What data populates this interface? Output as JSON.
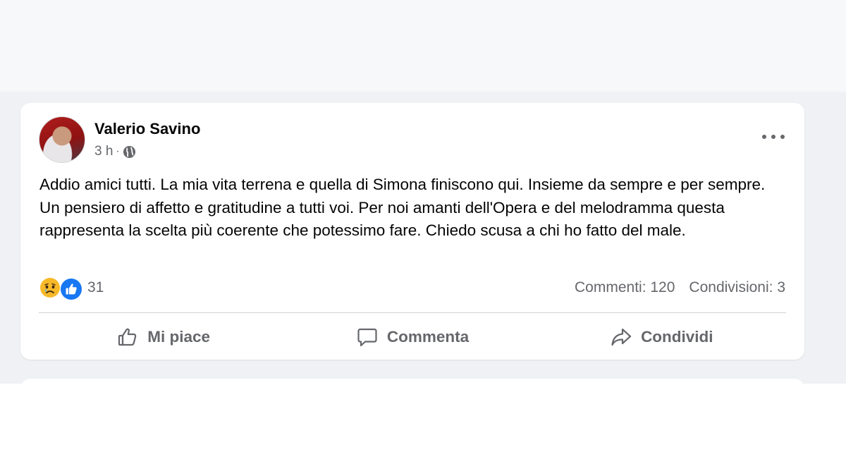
{
  "post": {
    "author": "Valerio Savino",
    "time": "3 h",
    "separator": "·",
    "text": "Addio amici tutti. La mia vita terrena e quella di Simona finiscono qui. Insieme da sempre e per sempre. Un pensiero di affetto e gratitudine a tutti voi. Per noi amanti dell'Opera e del melodramma questa rappresenta la scelta più coerente che potessimo fare. Chiedo scusa a chi ho fatto del male.",
    "reactions": {
      "icons": [
        "sad-reaction-icon",
        "like-reaction-icon"
      ],
      "count": "31"
    },
    "comments": "Commenti: 120",
    "shares": "Condivisioni: 3",
    "actions": {
      "like": "Mi piace",
      "comment": "Commenta",
      "share": "Condividi"
    }
  },
  "colors": {
    "like_blue": "#1877f2",
    "sad_yellow": "#f7b928",
    "secondary_text": "#65676b",
    "primary_text": "#050505",
    "feed_background": "#eff1f4"
  }
}
